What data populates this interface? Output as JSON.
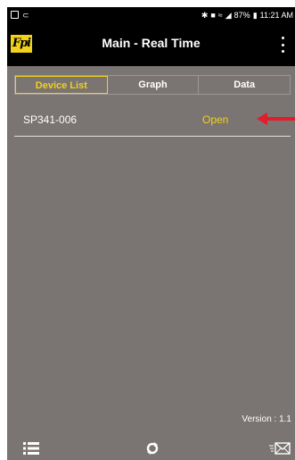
{
  "status_bar": {
    "left_icons": [
      "image-icon",
      "cast-icon"
    ],
    "right_text": "87%",
    "time": "11:21 AM"
  },
  "app_bar": {
    "logo_text": "Fpi",
    "title": "Main - Real Time",
    "menu_icon": "kebab-menu-icon"
  },
  "tabs": [
    {
      "label": "Device List",
      "active": true
    },
    {
      "label": "Graph",
      "active": false
    },
    {
      "label": "Data",
      "active": false
    }
  ],
  "devices": [
    {
      "name": "SP341-006",
      "status": "Open"
    }
  ],
  "footer": {
    "version": "Version : 1.1",
    "icons": [
      "list-icon",
      "refresh-icon",
      "email-icon"
    ]
  },
  "colors": {
    "background": "#7a7472",
    "bar": "#000000",
    "accent": "#f1d21a",
    "arrow": "#e11d2a"
  }
}
